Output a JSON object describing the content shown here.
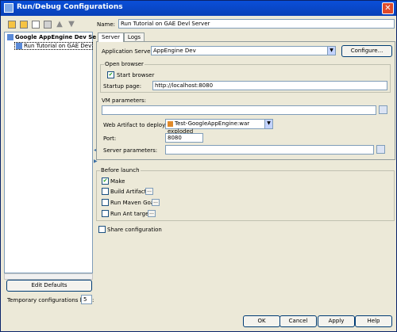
{
  "window": {
    "title": "Run/Debug Configurations",
    "close_glyph": "✕"
  },
  "toolbar": {
    "up_glyph": "▲",
    "down_glyph": "▼"
  },
  "tree": {
    "group_label": "Google AppEngine Dev Se",
    "item_label": "Run Tutorial on GAE Dev"
  },
  "left": {
    "edit_defaults_label": "Edit Defaults",
    "limit_label": "Temporary configurations limit:",
    "limit_value": "5"
  },
  "splitter": {
    "left_arrow": "◀",
    "right_arrow": "▶"
  },
  "name": {
    "label": "Name:",
    "value": "Run Tutorial on GAE Devl Server"
  },
  "tabs": [
    {
      "label": "Server",
      "selected": true
    },
    {
      "label": "Logs",
      "selected": false
    }
  ],
  "server": {
    "app_server_label": "Application Server:",
    "app_server_value": "AppEngine Dev",
    "configure_label": "Configure...",
    "open_browser_legend": "Open browser",
    "start_browser_label": "Start browser",
    "start_browser_checked": true,
    "startup_page_label": "Startup page:",
    "startup_page_value": "http://localhost:8080",
    "vm_params_label": "VM parameters:",
    "vm_params_value": "",
    "web_artifact_label": "Web Artifact to deploy:",
    "web_artifact_value": "Test-GoogleAppEngine:war exploded",
    "port_label": "Port:",
    "port_value": "8080",
    "server_params_label": "Server parameters:",
    "server_params_value": ""
  },
  "before_launch": {
    "legend": "Before launch",
    "items": [
      {
        "label": "Make",
        "checked": true,
        "has_options": false
      },
      {
        "label": "Build Artifacts",
        "checked": false,
        "has_options": true
      },
      {
        "label": "Run Maven Goal",
        "checked": false,
        "has_options": true
      },
      {
        "label": "Run Ant target",
        "checked": false,
        "has_options": true
      }
    ],
    "options_glyph": "..."
  },
  "share": {
    "label": "Share configuration",
    "checked": false
  },
  "check_glyph": "✔",
  "dropdown_glyph": "▼",
  "buttons": {
    "ok": "OK",
    "cancel": "Cancel",
    "apply": "Apply",
    "help": "Help"
  }
}
